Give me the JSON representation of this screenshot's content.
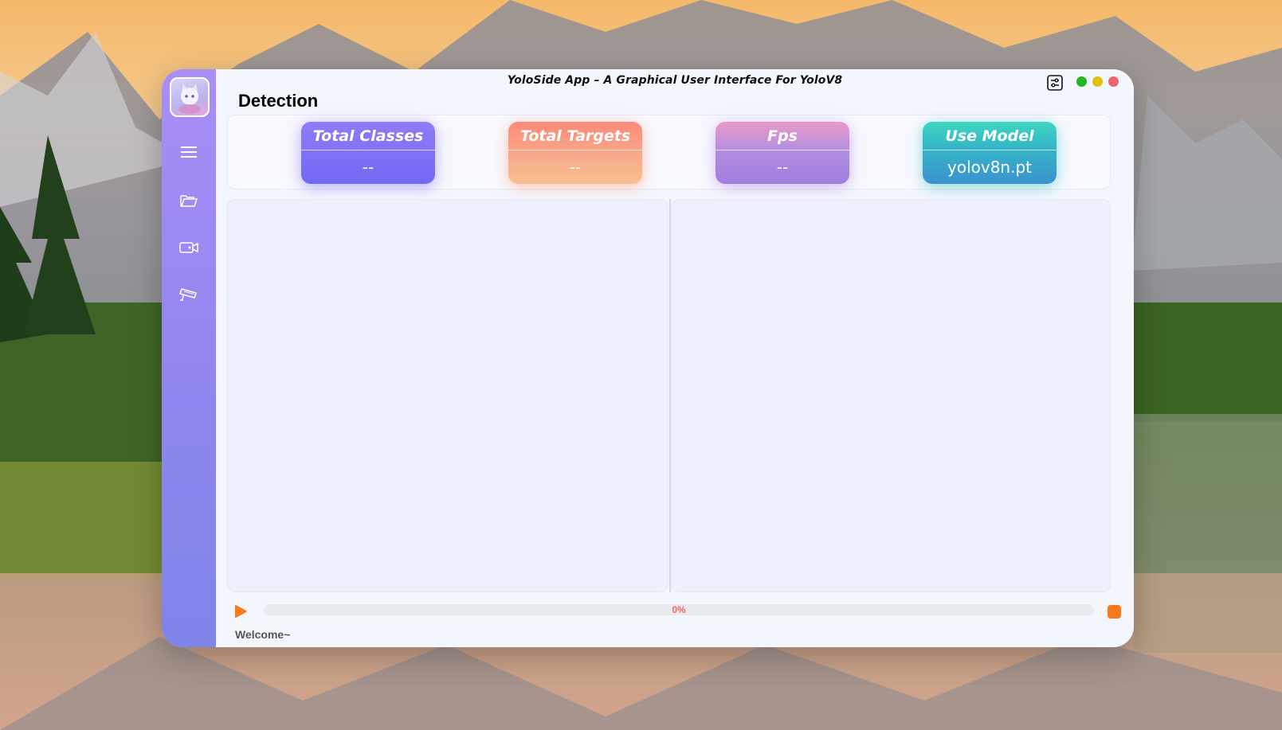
{
  "app": {
    "title": "YoloSide App  –  A Graphical User Interface For YoloV8",
    "page_title": "Detection"
  },
  "window_controls": {
    "settings_icon": "settings-sliders-icon",
    "buttons": [
      "minimize",
      "maximize",
      "close"
    ],
    "colors": {
      "green": "#23b523",
      "yellow": "#e0c20c",
      "red": "#f0636a"
    }
  },
  "sidebar": {
    "logo_icon": "anime-cat-avatar-logo",
    "items": [
      {
        "icon": "menu-icon",
        "name": "menu"
      },
      {
        "icon": "folder-icon",
        "name": "open-file"
      },
      {
        "icon": "camera-icon",
        "name": "camera"
      },
      {
        "icon": "cctv-icon",
        "name": "rtsp-stream"
      }
    ]
  },
  "stats": {
    "total_classes": {
      "label": "Total Classes",
      "value": "--"
    },
    "total_targets": {
      "label": "Total Targets",
      "value": "--"
    },
    "fps": {
      "label": "Fps",
      "value": "--"
    },
    "use_model": {
      "label": "Use Model",
      "value": "yolov8n.pt"
    }
  },
  "controls": {
    "play_icon": "play-icon",
    "stop_icon": "stop-icon",
    "progress_value": 0,
    "progress_text": "0%"
  },
  "status": {
    "text": "Welcome~"
  },
  "colors": {
    "sidebar_top": "#a98ef6",
    "sidebar_bottom": "#7f84e8",
    "accent_orange": "#f77a1a",
    "progress_text": "#f1665f"
  }
}
